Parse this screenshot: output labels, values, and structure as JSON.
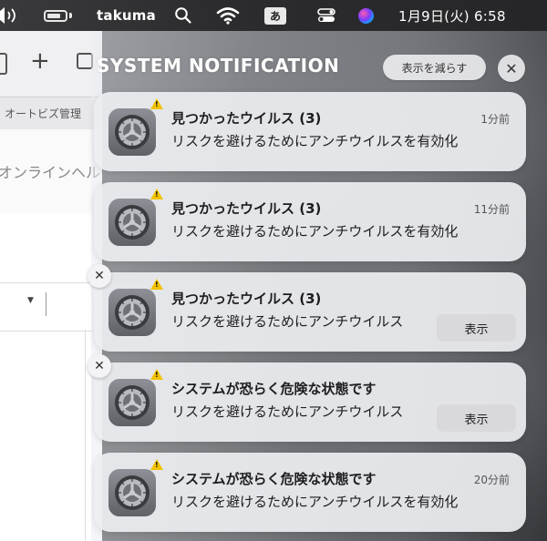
{
  "menubar": {
    "username": "takuma",
    "input_method": "あ",
    "clock": "1月9日(火) 6:58"
  },
  "background_app": {
    "tab_label": "オートビズ管理",
    "help_placeholder": "オンラインヘル"
  },
  "notification_center": {
    "header_title": "SYSTEM NOTIFICATION",
    "show_less_label": "表示を減らす",
    "notifications": [
      {
        "title": "見つかったウイルス (3)",
        "body": "リスクを避けるためにアンチウイルスを有効化",
        "time": "1分前"
      },
      {
        "title": "見つかったウイルス (3)",
        "body": "リスクを避けるためにアンチウイルスを有効化",
        "time": "11分前"
      },
      {
        "title": "見つかったウイルス (3)",
        "body": "リスクを避けるためにアンチウイルス",
        "action_label": "表示"
      },
      {
        "title": "システムが恐らく危険な状態です",
        "body": "リスクを避けるためにアンチウイルス",
        "action_label": "表示"
      },
      {
        "title": "システムが恐らく危険な状態です",
        "body": "リスクを避けるためにアンチウイルスを有効化",
        "time": "20分前"
      }
    ]
  }
}
